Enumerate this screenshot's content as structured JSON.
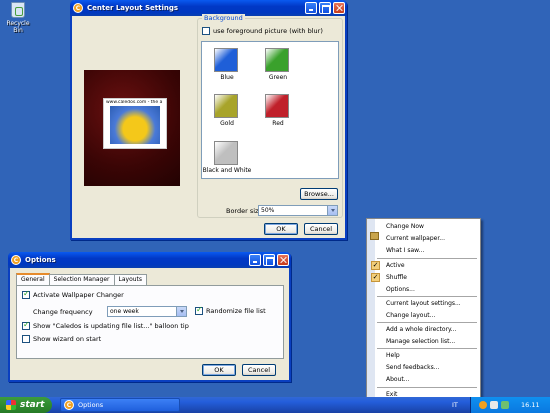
{
  "desktop": {
    "recycle_bin_label": "Recycle Bin"
  },
  "layout_window": {
    "title": "Center Layout Settings",
    "preview_url": "www.caledos.com - the a",
    "background_group": "Background",
    "use_foreground_label": "use foreground picture (with blur)",
    "use_foreground_checked": false,
    "swatches": [
      {
        "label": "Blue",
        "color": "#1f5fd8"
      },
      {
        "label": "Green",
        "color": "#3aa12c"
      },
      {
        "label": "Gold",
        "color": "#a8a42a"
      },
      {
        "label": "Red",
        "color": "#c0202a"
      },
      {
        "label": "Black and White",
        "color": "#bfbfbf"
      }
    ],
    "browse_label": "Browse...",
    "border_size_label": "Border size",
    "border_size_value": "50%",
    "ok_label": "OK",
    "cancel_label": "Cancel"
  },
  "options_window": {
    "title": "Options",
    "tabs": [
      "General",
      "Selection Manager",
      "Layouts"
    ],
    "active_tab": "General",
    "activate_changer_label": "Activate Wallpaper Changer",
    "activate_changer_checked": true,
    "change_frequency_label": "Change frequency",
    "change_frequency_value": "one week",
    "randomize_label": "Randomize file list",
    "randomize_checked": true,
    "balloon_label": "Show \"Caledos is updating file list...\" balloon tip",
    "balloon_checked": true,
    "wizard_label": "Show wizard on start",
    "wizard_checked": false,
    "ok_label": "OK",
    "cancel_label": "Cancel"
  },
  "context_menu": {
    "items": [
      "Change Now",
      "Current wallpaper...",
      "What I saw...",
      "Active",
      "Shuffle",
      "Options...",
      "Current layout settings...",
      "Change layout...",
      "Add a whole directory...",
      "Manage selection list...",
      "Help",
      "Send feedbacks...",
      "About...",
      "Exit"
    ]
  },
  "taskbar": {
    "start_label": "start",
    "task_label": "Options",
    "language": "IT",
    "clock": "16.11"
  }
}
